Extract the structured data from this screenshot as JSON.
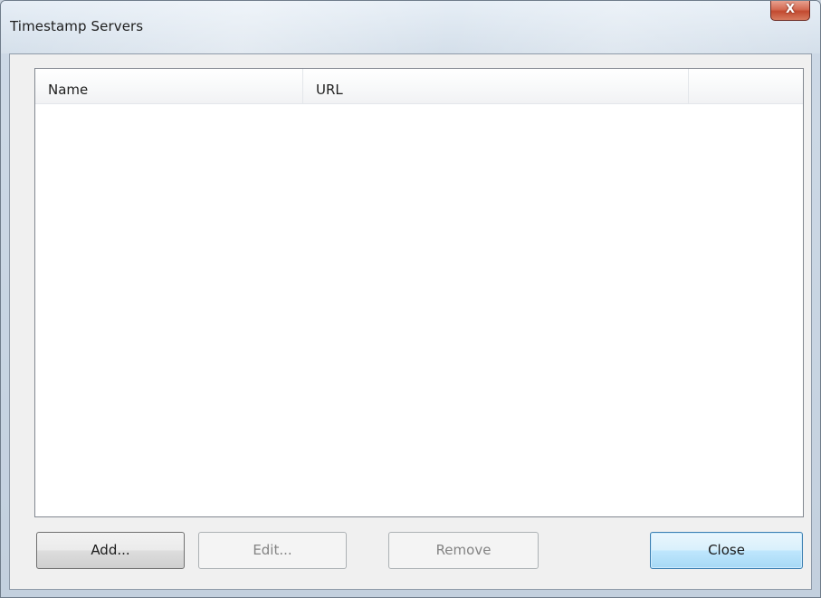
{
  "window": {
    "title": "Timestamp Servers",
    "close_glyph": "X"
  },
  "list": {
    "columns": [
      "Name",
      "URL",
      ""
    ],
    "rows": []
  },
  "buttons": {
    "add": "Add...",
    "edit": "Edit...",
    "remove": "Remove",
    "close": "Close"
  },
  "state": {
    "edit_enabled": false,
    "remove_enabled": false,
    "close_is_default": true
  }
}
